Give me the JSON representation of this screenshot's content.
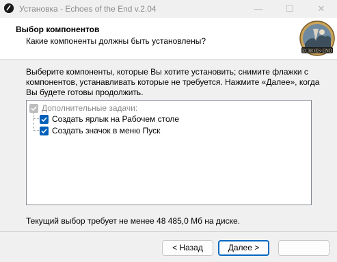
{
  "window": {
    "title": "Установка - Echoes of the End v.2.04",
    "controls": {
      "minimize": "—",
      "maximize": "☐",
      "close": "✕"
    }
  },
  "header": {
    "title": "Выбор компонентов",
    "subtitle": "Какие компоненты должны быть установлены?",
    "logo_text": "ECHOES END"
  },
  "body": {
    "description": "Выберите компоненты, которые Вы хотите установить; снимите флажки с компонентов, устанавливать которые не требуется. Нажмите «Далее», когда Вы будете готовы продолжить.",
    "components": [
      {
        "label": "Дополнительные задачи:",
        "checked": true,
        "enabled": false
      },
      {
        "label": "Создать ярлык на Рабочем столе",
        "checked": true,
        "enabled": true
      },
      {
        "label": "Создать значок в меню Пуск",
        "checked": true,
        "enabled": true
      }
    ],
    "space_required": "Текущий выбор требует не менее 48 485,0 Мб на диске."
  },
  "buttons": {
    "back": "< Назад",
    "next": "Далее >",
    "cancel": ""
  },
  "colors": {
    "accent": "#005fb8",
    "default_button_border": "#0067c0"
  }
}
